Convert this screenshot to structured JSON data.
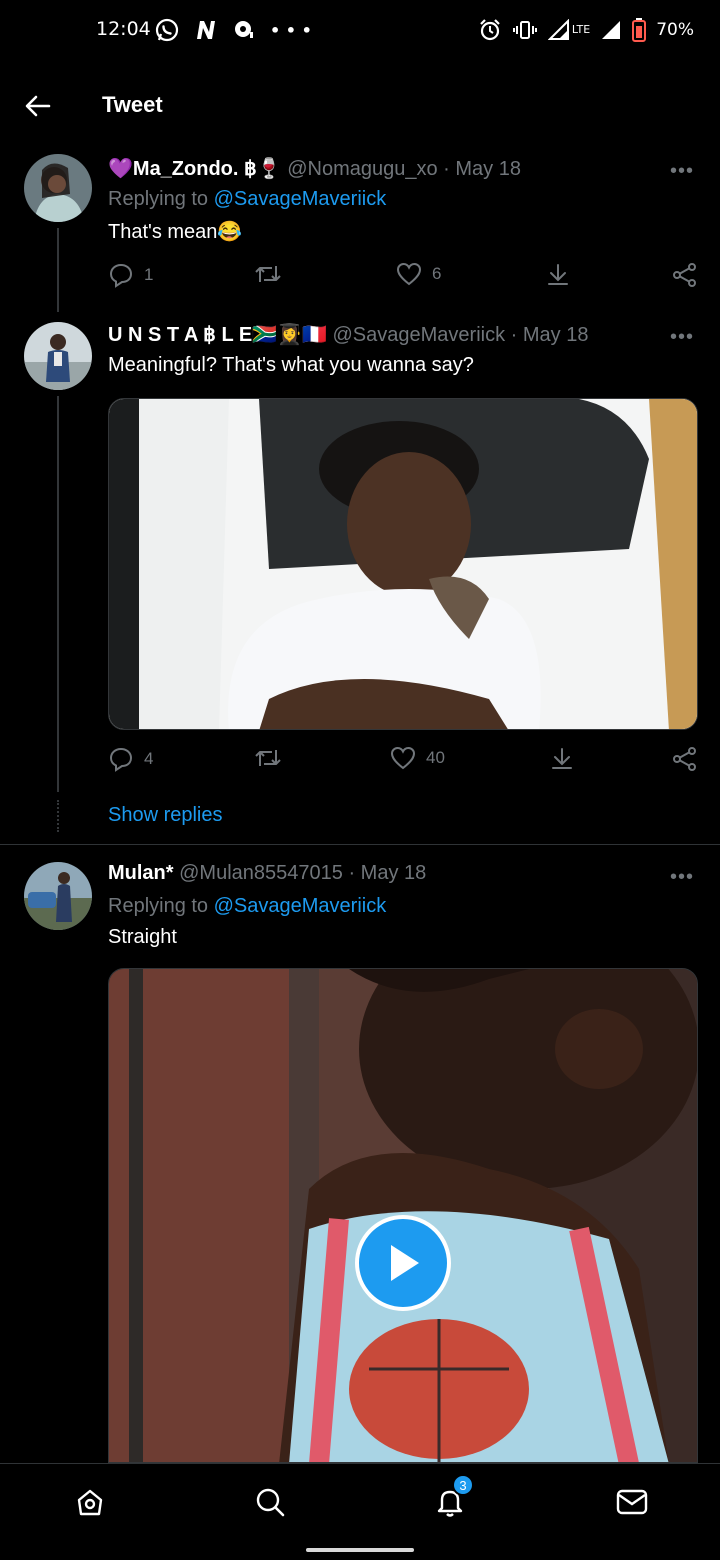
{
  "status_bar": {
    "time": "12:04",
    "battery": "70%",
    "network": "LTE",
    "icons_left": [
      "whatsapp-icon",
      "n-icon",
      "chat-icon",
      "more-dots-icon"
    ],
    "icons_right": [
      "alarm-icon",
      "vibrate-icon",
      "signal-icon",
      "signal-icon",
      "battery-icon"
    ]
  },
  "header": {
    "title": "Tweet"
  },
  "tweets": [
    {
      "name": "💜Ma_Zondo. ฿🍷",
      "handle": "@Nomagugu_xo",
      "date": "· May 18",
      "replying_prefix": "Replying to",
      "replying_to": "@SavageMaveriick",
      "text": "That's mean😂",
      "replies": "1",
      "retweets": "",
      "likes": "6"
    },
    {
      "name": "U N S T A ฿ L E🇿🇦👩‍🎓🇫🇷",
      "handle": "@SavageMaveriick",
      "date": "· May 18",
      "text": "Meaningful? That's what you wanna say?",
      "replies": "4",
      "retweets": "",
      "likes": "40"
    },
    {
      "name": "Mulan*",
      "handle": "@Mulan85547015",
      "date": "· May 18",
      "replying_prefix": "Replying to",
      "replying_to": "@SavageMaveriick",
      "text": "Straight"
    }
  ],
  "show_replies": "Show replies",
  "more_glyph": "•••",
  "nav": {
    "items": [
      "home-icon",
      "search-icon",
      "notifications-icon",
      "messages-icon"
    ],
    "notification_badge": "3"
  },
  "colors": {
    "accent": "#1d9bf0",
    "muted": "#71767b",
    "background": "#000000"
  }
}
